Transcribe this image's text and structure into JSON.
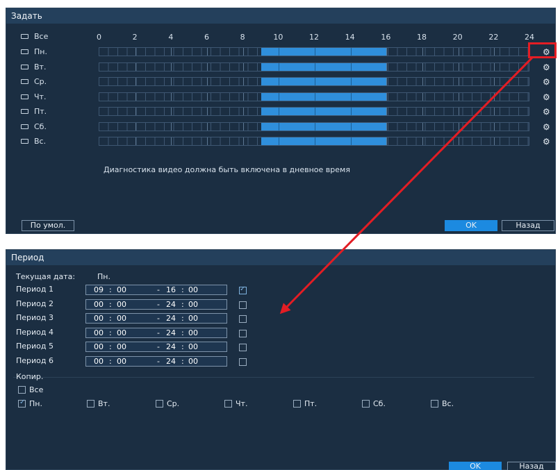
{
  "schedule_dialog": {
    "title": "Задать",
    "all_label": "Все",
    "hours": [
      "0",
      "2",
      "4",
      "6",
      "8",
      "10",
      "12",
      "14",
      "16",
      "18",
      "20",
      "22",
      "24"
    ],
    "days": [
      {
        "label": "Пн.",
        "periods": [
          [
            9,
            16
          ]
        ]
      },
      {
        "label": "Вт.",
        "periods": [
          [
            9,
            16
          ]
        ]
      },
      {
        "label": "Ср.",
        "periods": [
          [
            9,
            16
          ]
        ]
      },
      {
        "label": "Чт.",
        "periods": [
          [
            9,
            16
          ]
        ]
      },
      {
        "label": "Пт.",
        "periods": [
          [
            9,
            16
          ]
        ]
      },
      {
        "label": "Сб.",
        "periods": [
          [
            9,
            16
          ]
        ]
      },
      {
        "label": "Вс.",
        "periods": [
          [
            9,
            16
          ]
        ]
      }
    ],
    "note": "Диагностика видео должна быть включена в дневное время",
    "default_button": "По умол.",
    "ok_button": "OK",
    "back_button": "Назад",
    "gear_icon": "gear-icon"
  },
  "period_dialog": {
    "title": "Период",
    "current_date_label": "Текущая дата:",
    "current_date_value": "Пн.",
    "periods": [
      {
        "label": "Период 1",
        "start_h": "09",
        "start_m": "00",
        "end_h": "16",
        "end_m": "00",
        "checked": true
      },
      {
        "label": "Период 2",
        "start_h": "00",
        "start_m": "00",
        "end_h": "24",
        "end_m": "00",
        "checked": false
      },
      {
        "label": "Период 3",
        "start_h": "00",
        "start_m": "00",
        "end_h": "24",
        "end_m": "00",
        "checked": false
      },
      {
        "label": "Период 4",
        "start_h": "00",
        "start_m": "00",
        "end_h": "24",
        "end_m": "00",
        "checked": false
      },
      {
        "label": "Период 5",
        "start_h": "00",
        "start_m": "00",
        "end_h": "24",
        "end_m": "00",
        "checked": false
      },
      {
        "label": "Период 6",
        "start_h": "00",
        "start_m": "00",
        "end_h": "24",
        "end_m": "00",
        "checked": false
      }
    ],
    "time_colon": ":",
    "time_dash": "-",
    "copy_label": "Копир.",
    "copy_all_label": "Все",
    "copy_days": [
      {
        "label": "Пн.",
        "checked": true
      },
      {
        "label": "Вт.",
        "checked": false
      },
      {
        "label": "Ср.",
        "checked": false
      },
      {
        "label": "Чт.",
        "checked": false
      },
      {
        "label": "Пт.",
        "checked": false
      },
      {
        "label": "Сб.",
        "checked": false
      },
      {
        "label": "Вс.",
        "checked": false
      }
    ],
    "ok_button": "OK",
    "back_button": "Назад"
  },
  "annotation": {
    "highlight_color": "#e31d24"
  },
  "colors": {
    "panel_bg": "#1b2e42",
    "titlebar_bg": "#24405c",
    "schedule_fill": "#2f8fdc",
    "primary_button": "#1c8ae0"
  }
}
